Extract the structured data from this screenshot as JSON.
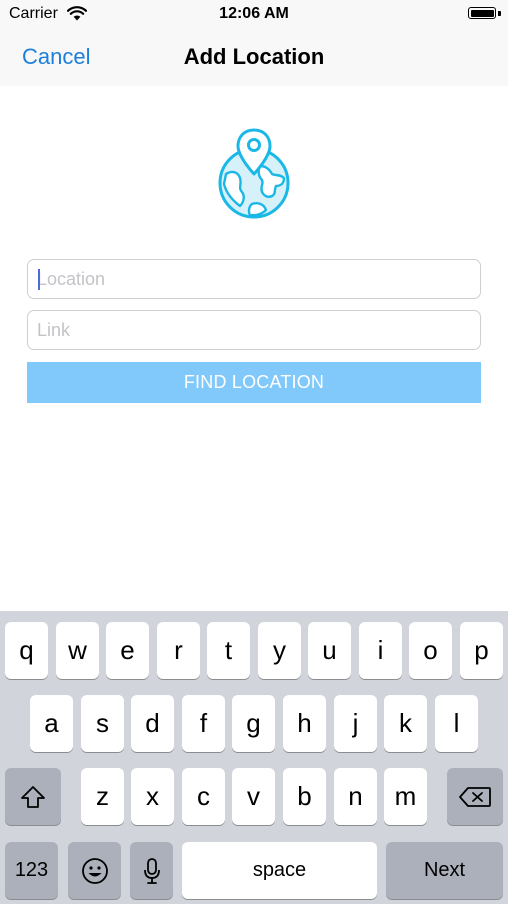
{
  "status_bar": {
    "carrier": "Carrier",
    "time": "12:06 AM"
  },
  "nav": {
    "cancel_label": "Cancel",
    "title": "Add Location"
  },
  "icons": {
    "header": "globe-location-pin-icon"
  },
  "form": {
    "location": {
      "placeholder": "Location",
      "value": ""
    },
    "link": {
      "placeholder": "Link",
      "value": ""
    },
    "find_button_label": "FIND LOCATION"
  },
  "keyboard": {
    "row1": [
      "q",
      "w",
      "e",
      "r",
      "t",
      "y",
      "u",
      "i",
      "o",
      "p"
    ],
    "row2": [
      "a",
      "s",
      "d",
      "f",
      "g",
      "h",
      "j",
      "k",
      "l"
    ],
    "row3": [
      "z",
      "x",
      "c",
      "v",
      "b",
      "n",
      "m"
    ],
    "numbers_label": "123",
    "space_label": "space",
    "return_label": "Next"
  },
  "colors": {
    "accent": "#1c7fdc",
    "button_bg": "#81c9fb",
    "icon": "#1ab8e6",
    "keyboard_bg": "#d1d4da"
  }
}
